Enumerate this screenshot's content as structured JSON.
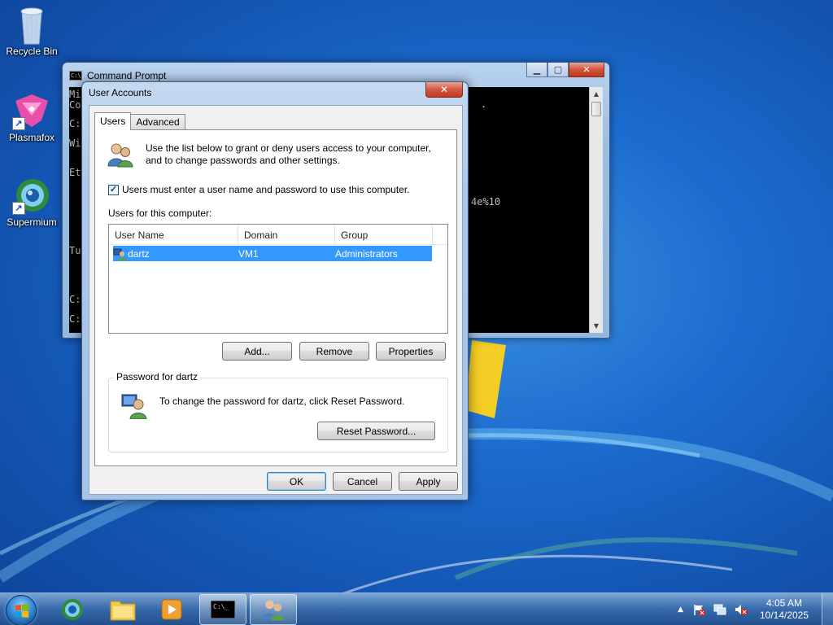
{
  "desktop": {
    "icons": [
      {
        "label": "Recycle Bin"
      },
      {
        "label": "Plasmafox"
      },
      {
        "label": "Supermium"
      }
    ]
  },
  "cmd": {
    "title": "Command Prompt",
    "lines": [
      "Mi",
      "Co",
      "C:",
      "Wi",
      "Et",
      "Tu",
      "C:",
      "C:"
    ],
    "fragments": [
      ".",
      "4e%10"
    ]
  },
  "dialog": {
    "title": "User Accounts",
    "tabs": [
      "Users",
      "Advanced"
    ],
    "intro": "Use the list below to grant or deny users access to your computer, and to change passwords and other settings.",
    "must_login_label": "Users must enter a user name and password to use this computer.",
    "must_login_checked": true,
    "users_label": "Users for this computer:",
    "columns": [
      "User Name",
      "Domain",
      "Group"
    ],
    "rows": [
      {
        "name": "dartz",
        "domain": "VM1",
        "group": "Administrators",
        "selected": true
      }
    ],
    "buttons": {
      "add": "Add...",
      "remove": "Remove",
      "properties": "Properties"
    },
    "password_group_title": "Password for dartz",
    "password_text": "To change the password for dartz, click Reset Password.",
    "reset_button": "Reset Password...",
    "footer": {
      "ok": "OK",
      "cancel": "Cancel",
      "apply": "Apply"
    }
  },
  "taskbar": {
    "time": "4:05 AM",
    "date": "10/14/2025",
    "tray_arrow": "▲"
  },
  "colors": {
    "selection": "#3399ff",
    "desktop": "#1c6ccf"
  }
}
